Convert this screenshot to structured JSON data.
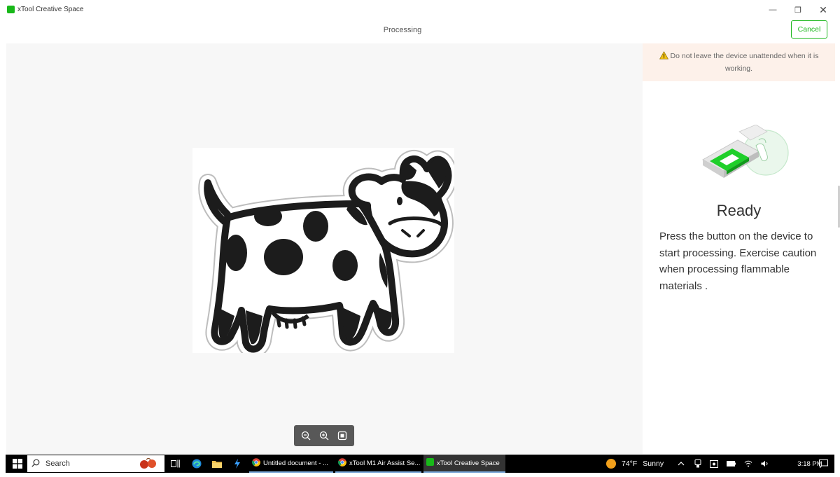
{
  "window": {
    "title": "xTool Creative Space",
    "minimize_glyph": "—",
    "restore_glyph": "❐",
    "close_glyph": "✕"
  },
  "header": {
    "title": "Processing",
    "cancel_label": "Cancel"
  },
  "canvas": {
    "artwork_icon": "cow-sticker-image",
    "zoom_controls": [
      "zoom-out-icon",
      "zoom-in-icon",
      "fit-to-screen-icon"
    ]
  },
  "panel": {
    "warning_text": "Do not leave the device unattended when it is working.",
    "status_title": "Ready",
    "status_description": "Press the button on the device to start processing. Exercise caution when processing flammable materials ."
  },
  "taskbar": {
    "search_label": "Search",
    "items": [
      {
        "label": "Untitled document - ...",
        "icon": "chrome-icon",
        "state": "running"
      },
      {
        "label": "xTool M1 Air Assist Se...",
        "icon": "chrome-icon",
        "state": "running"
      },
      {
        "label": "xTool Creative Space",
        "icon": "xtool-app-icon",
        "state": "active"
      }
    ],
    "weather": {
      "temperature": "74°F",
      "condition": "Sunny"
    },
    "clock": "3:18 PM"
  },
  "colors": {
    "accent_green": "#1fb81f",
    "warning_bg": "#fdf1ea",
    "warning_icon": "#f5c518",
    "taskbar_bg": "#000000"
  }
}
